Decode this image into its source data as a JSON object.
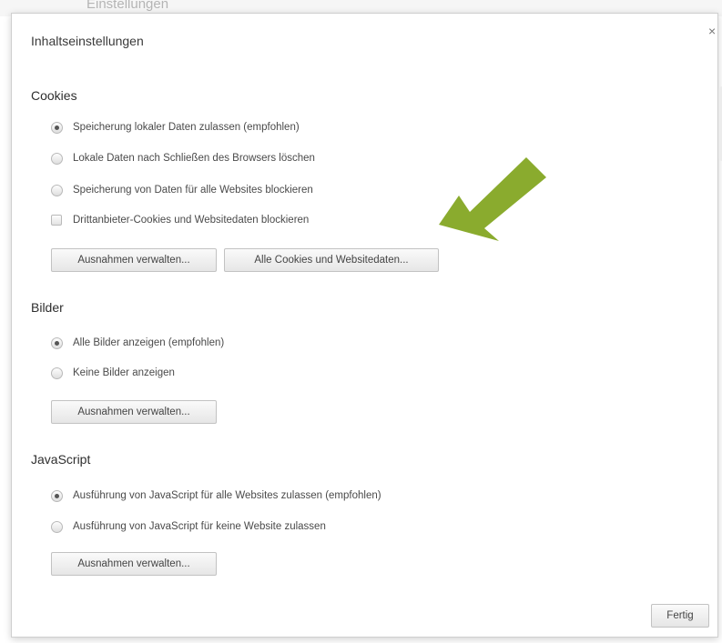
{
  "background": {
    "title_fragment": "Einstellungen",
    "right_fragment": "Einstellungen"
  },
  "dialog": {
    "title": "Inhaltseinstellungen",
    "close_glyph": "×",
    "done_button": "Fertig"
  },
  "sections": {
    "cookies": {
      "title": "Cookies",
      "options": [
        {
          "label": "Speicherung lokaler Daten zulassen (empfohlen)",
          "checked": true
        },
        {
          "label": "Lokale Daten nach Schließen des Browsers löschen",
          "checked": false
        },
        {
          "label": "Speicherung von Daten für alle Websites blockieren",
          "checked": false
        }
      ],
      "checkbox": {
        "label": "Drittanbieter-Cookies und Websitedaten blockieren",
        "checked": false
      },
      "exceptions_button": "Ausnahmen verwalten...",
      "all_cookies_button": "Alle Cookies und Websitedaten..."
    },
    "images": {
      "title": "Bilder",
      "options": [
        {
          "label": "Alle Bilder anzeigen (empfohlen)",
          "checked": true
        },
        {
          "label": "Keine Bilder anzeigen",
          "checked": false
        }
      ],
      "exceptions_button": "Ausnahmen verwalten..."
    },
    "javascript": {
      "title": "JavaScript",
      "options": [
        {
          "label": "Ausführung von JavaScript für alle Websites zulassen (empfohlen)",
          "checked": true
        },
        {
          "label": "Ausführung von JavaScript für keine Website zulassen",
          "checked": false
        }
      ],
      "exceptions_button": "Ausnahmen verwalten..."
    }
  },
  "annotation": {
    "arrow_color": "#8aab2e",
    "icon": "arrow-pointing-down-left"
  }
}
